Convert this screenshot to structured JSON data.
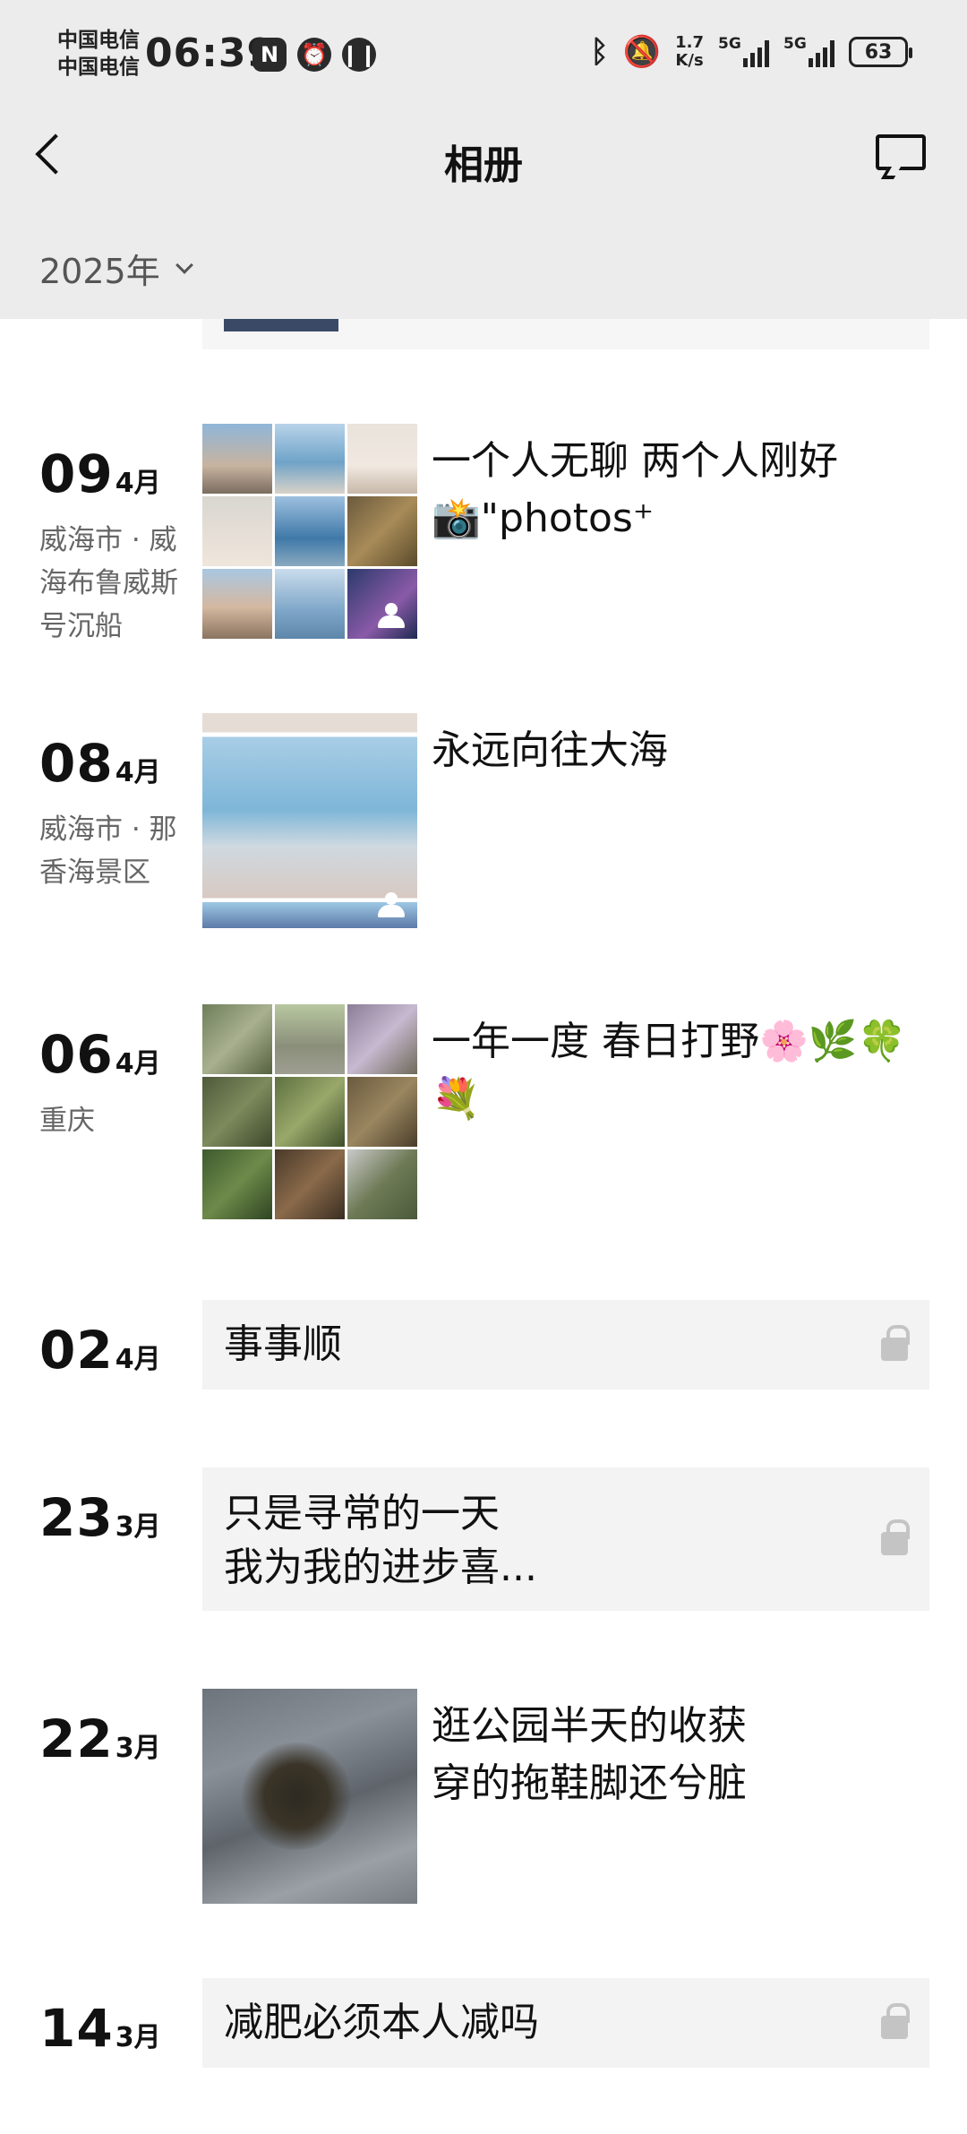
{
  "status_bar": {
    "carrier_1": "中国电信",
    "carrier_2": "中国电信",
    "time": "06:39",
    "network_speed_value": "1.7",
    "network_speed_unit": "K/s",
    "signal_1": "5G",
    "signal_2": "5G",
    "battery": "63"
  },
  "header": {
    "title": "相册",
    "year_selector": "2025年"
  },
  "entries": [
    {
      "day": "09",
      "month": "4月",
      "location": "威海市 · 威海布鲁威斯号沉船",
      "type": "photos",
      "photo_count_shown": 9,
      "caption": "一个人无聊 两个人刚好 📸\"photos⁺"
    },
    {
      "day": "08",
      "month": "4月",
      "location": "威海市 · 那香海景区",
      "type": "photo",
      "caption": "永远向往大海"
    },
    {
      "day": "06",
      "month": "4月",
      "location": "重庆",
      "type": "photos",
      "photo_count_shown": 9,
      "caption": "一年一度 春日打野🌸🌿🍀💐"
    },
    {
      "day": "02",
      "month": "4月",
      "type": "text",
      "private": true,
      "caption": "事事顺"
    },
    {
      "day": "23",
      "month": "3月",
      "type": "text",
      "private": true,
      "caption_line_1": "只是寻常的一天",
      "caption_line_2": "我为我的进步喜..."
    },
    {
      "day": "22",
      "month": "3月",
      "type": "photo",
      "caption_line_1": "逛公园半天的收获",
      "caption_line_2": "穿的拖鞋脚还兮脏"
    },
    {
      "day": "14",
      "month": "3月",
      "type": "text",
      "private": true,
      "caption": "减肥必须本人减吗"
    }
  ],
  "colors": {
    "header_bg": "#ececec",
    "text_card_bg": "#f3f3f3",
    "secondary_text": "#666666",
    "lock_gray": "#c4c4c4"
  },
  "icons": [
    "back-arrow-icon",
    "message-icon",
    "chevron-down-icon",
    "lock-icon",
    "multi-person-icon",
    "bluetooth-icon",
    "mute-bell-icon",
    "nfc-icon",
    "alarm-icon",
    "pause-icon"
  ]
}
